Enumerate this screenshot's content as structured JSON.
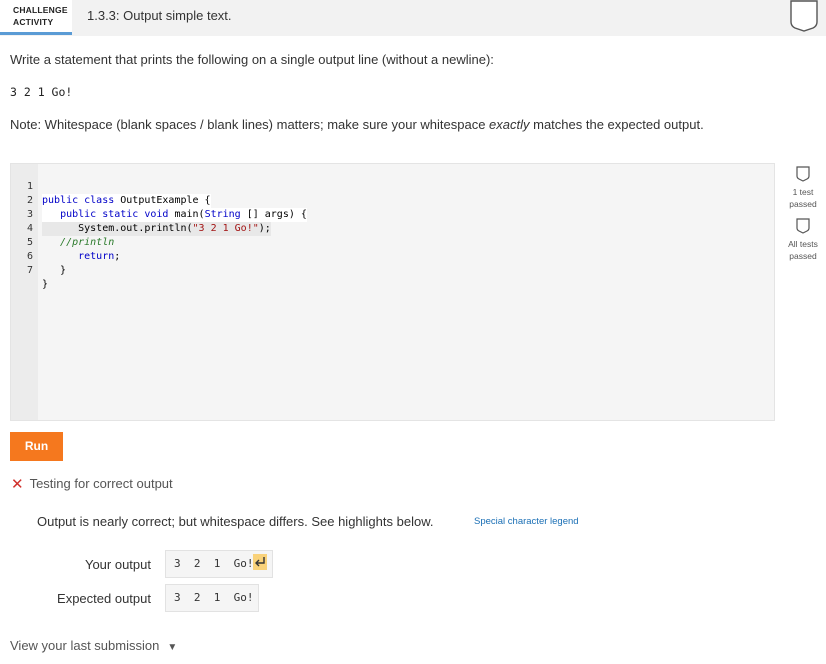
{
  "header": {
    "badge_line1": "CHALLENGE",
    "badge_line2": "ACTIVITY",
    "title": "1.3.3: Output simple text.",
    "accent": "#5a9bd5"
  },
  "instructions": {
    "main": "Write a statement that prints the following on a single output line (without a newline):",
    "target": "3  2  1  Go!",
    "note_prefix": "Note: Whitespace (blank spaces / blank lines) matters; make sure your whitespace ",
    "note_emph": "exactly",
    "note_suffix": " matches the expected output."
  },
  "editor": {
    "lines": [
      {
        "num": "1",
        "text": "public class OutputExample {"
      },
      {
        "num": "2",
        "text": "   public static void main(String [] args) {"
      },
      {
        "num": "3",
        "text": "      System.out.println(\"3 2 1 Go!\");"
      },
      {
        "num": "4",
        "text": "   //println"
      },
      {
        "num": "5",
        "text": "      return;"
      },
      {
        "num": "6",
        "text": "   }"
      },
      {
        "num": "7",
        "text": "}"
      }
    ]
  },
  "side_status": {
    "first_line1": "1 test",
    "first_line2": "passed",
    "second_line1": "All tests",
    "second_line2": "passed"
  },
  "run_button": {
    "label": "Run",
    "color": "#f5781e"
  },
  "result": {
    "status_icon": "x-icon",
    "status_text": "Testing for correct output",
    "message": "Output is nearly correct; but whitespace differs. See highlights below.",
    "legend_link": "Special character legend",
    "your_output_label": "Your output",
    "your_output_value": "3  2  1  Go!",
    "expected_output_label": "Expected output",
    "expected_output_value": "3  2  1  Go!"
  },
  "footer": {
    "view_last": "View your last submission"
  }
}
